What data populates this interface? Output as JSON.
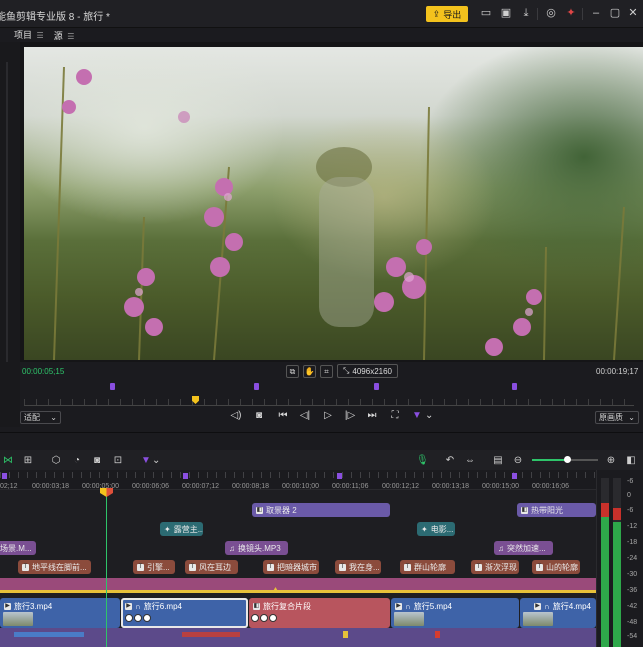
{
  "app": {
    "title": "能鱼剪辑专业版 8 - 旅行 *",
    "export_label": "导出",
    "accent": "#f3c21d"
  },
  "left_tabs": [
    {
      "label": "项目",
      "icon": "menu-icon"
    },
    {
      "label": "源",
      "icon": "menu-icon"
    }
  ],
  "preview": {
    "timecode_current": "00:00:05;15",
    "timecode_total": "00:00:19;17",
    "resolution": "4096x2160",
    "fit_select": "适配",
    "quality_select": "原画质"
  },
  "ruler": {
    "ticks": [
      "02;12",
      "00:00:03;18",
      "00:00:05;00",
      "00:00:06;06",
      "00:00:07;12",
      "00:00:08;18",
      "00:00:10;00",
      "00:00:11;06",
      "00:00:12;12",
      "00:00:13;18",
      "00:00:15;00",
      "00:00:16;06"
    ]
  },
  "tracks": {
    "effects": [
      {
        "label": "取景器 2"
      },
      {
        "label": "热带阳光"
      }
    ],
    "titles": [
      {
        "label": "露营主..."
      },
      {
        "label": "电影..."
      }
    ],
    "music": [
      {
        "label": "场景.M..."
      },
      {
        "label": "换镜头.MP3"
      },
      {
        "label": "突然加速..."
      }
    ],
    "subtitles": [
      {
        "label": "地平线在脚前..."
      },
      {
        "label": "引擎..."
      },
      {
        "label": "风在耳边"
      },
      {
        "label": "把暗器城市"
      },
      {
        "label": "我在身..."
      },
      {
        "label": "群山轮廓"
      },
      {
        "label": "渐次浮现"
      },
      {
        "label": "山的轮廓"
      }
    ],
    "video": [
      {
        "label": "旅行3.mp4"
      },
      {
        "label": "旅行6.mp4"
      },
      {
        "label": "旅行复合片段"
      },
      {
        "label": "旅行5.mp4"
      },
      {
        "label": "旅行4.mp4"
      }
    ]
  },
  "vu_meter": {
    "labels": [
      "-6",
      "0",
      "-6",
      "-12",
      "-18",
      "-24",
      "-30",
      "-36",
      "-42",
      "-48",
      "-54"
    ]
  }
}
